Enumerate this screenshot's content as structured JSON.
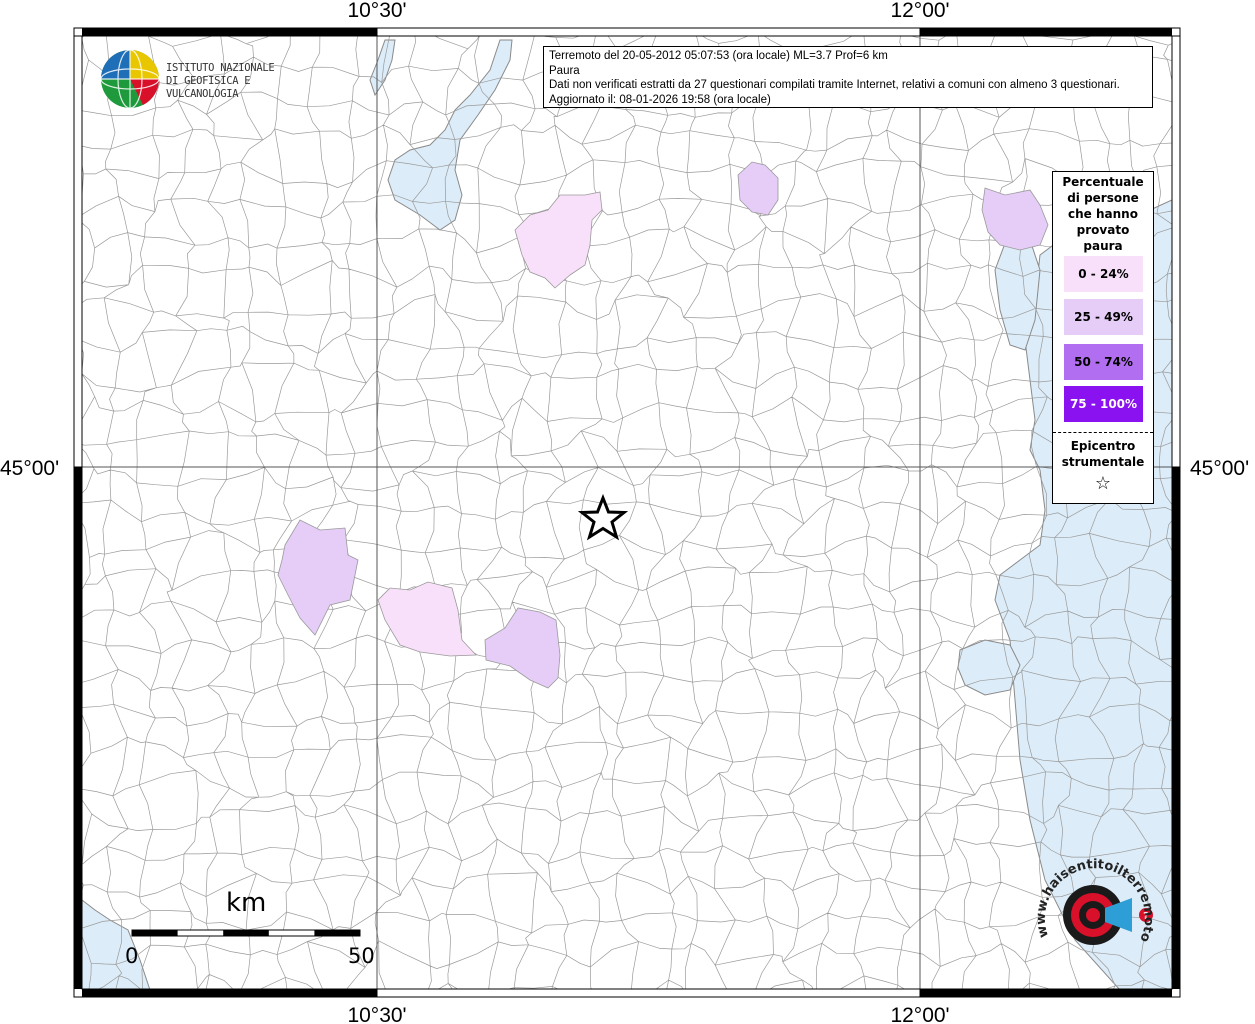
{
  "info": {
    "line1": "Terremoto del 20-05-2012 05:07:53 (ora locale) ML=3.7 Prof=6 km",
    "line2": "Paura",
    "line3": "Dati non verificati estratti da 27 questionari compilati tramite Internet, relativi a comuni con almeno 3 questionari.",
    "line4": "Aggiornato il: 08-01-2026 19:58 (ora locale)"
  },
  "axes": {
    "lon_top_left": "10°30'",
    "lon_top_right": "12°00'",
    "lon_bottom_left": "10°30'",
    "lon_bottom_right": "12°00'",
    "lat_left": "45°00'",
    "lat_right": "45°00'"
  },
  "logo": {
    "line1": "ISTITUTO NAZIONALE",
    "line2": "DI GEOFISICA E VULCANOLOGIA"
  },
  "legend": {
    "title_lines": [
      "Percentuale",
      "di persone",
      "che hanno",
      "provato",
      "paura"
    ],
    "classes": [
      {
        "label": "0 - 24%",
        "color": "#f9e0fa"
      },
      {
        "label": "25 - 49%",
        "color": "#e5cdf7"
      },
      {
        "label": "50 - 74%",
        "color": "#b26ef0"
      },
      {
        "label": "75 - 100%",
        "color": "#8a12f0"
      }
    ],
    "epicenter_lines": [
      "Epicentro",
      "strumentale"
    ],
    "epicenter_symbol": "☆"
  },
  "scale_bar": {
    "unit": "km",
    "start": "0",
    "end": "50"
  },
  "watermark": {
    "text": "www.haisentitoilterremoto.it",
    "accent": "#d8102a"
  },
  "colors": {
    "sea": "#dcecf8",
    "border": "#8a8a8a",
    "grid": "#555555"
  }
}
